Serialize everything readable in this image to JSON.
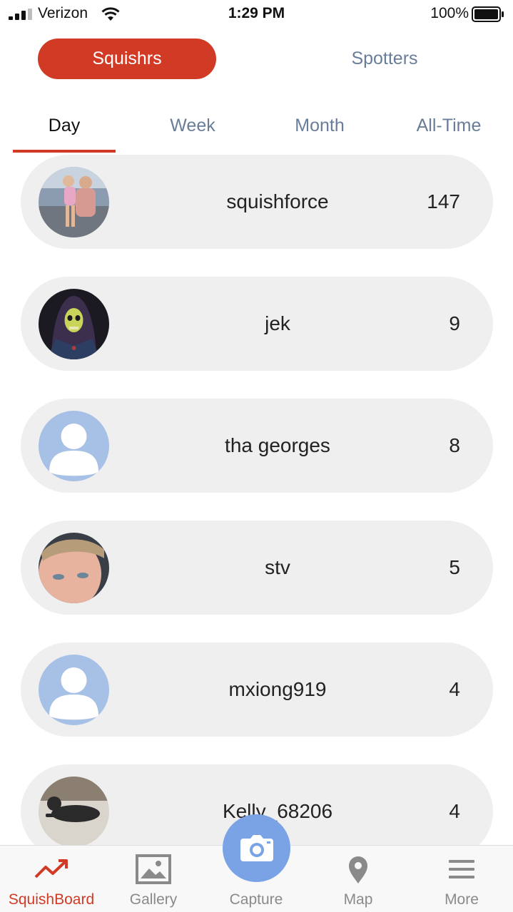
{
  "status_bar": {
    "carrier": "Verizon",
    "time": "1:29 PM",
    "battery_percent": "100%"
  },
  "segments": {
    "squishrs": "Squishrs",
    "spotters": "Spotters",
    "active": "squishrs"
  },
  "period_tabs": {
    "day": "Day",
    "week": "Week",
    "month": "Month",
    "all_time": "All-Time",
    "active": "day"
  },
  "leaderboard": [
    {
      "name": "squishforce",
      "score": "147",
      "avatar": "photo-family-avatar"
    },
    {
      "name": "jek",
      "score": "9",
      "avatar": "skeletor-avatar"
    },
    {
      "name": "tha georges",
      "score": "8",
      "avatar": "default-user-avatar"
    },
    {
      "name": "stv",
      "score": "5",
      "avatar": "face-photo-avatar"
    },
    {
      "name": "mxiong919",
      "score": "4",
      "avatar": "default-user-avatar"
    },
    {
      "name": "Kelly_68206",
      "score": "4",
      "avatar": "dog-photo-avatar"
    }
  ],
  "tab_bar": {
    "squishboard": "SquishBoard",
    "gallery": "Gallery",
    "capture": "Capture",
    "map": "Map",
    "more": "More",
    "active": "squishboard"
  },
  "colors": {
    "accent": "#d13a24",
    "inactive_text": "#6a7d98",
    "row_background": "#efefef",
    "capture_button": "#7aa3e6",
    "default_avatar": "#a7c1e6"
  }
}
